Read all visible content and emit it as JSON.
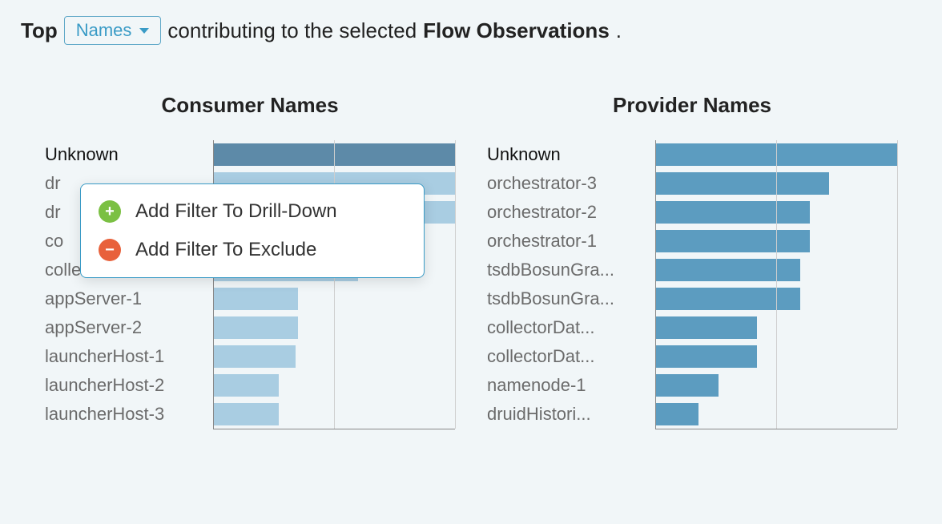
{
  "header": {
    "top": "Top",
    "dropdown_label": "Names",
    "middle": "contributing to the selected",
    "bold": "Flow Observations",
    "period": "."
  },
  "context_menu": {
    "add_drilldown": "Add Filter To Drill-Down",
    "add_exclude": "Add Filter To Exclude"
  },
  "colors": {
    "consumer_selected": "#5d8aa8",
    "consumer_bar": "#a9cde2",
    "provider_bar": "#5c9cc0"
  },
  "chart_data": [
    {
      "type": "bar",
      "title": "Consumer Names",
      "orientation": "horizontal",
      "xlim": [
        0,
        100
      ],
      "grid_ticks": [
        0,
        50,
        100
      ],
      "categories": [
        "Unknown",
        "dr",
        "dr",
        "co",
        "collectorDat...",
        "appServer-1",
        "appServer-2",
        "launcherHost-1",
        "launcherHost-2",
        "launcherHost-3"
      ],
      "values": [
        100,
        100,
        100,
        80,
        60,
        35,
        35,
        34,
        27,
        27
      ],
      "selected_index": 0,
      "obscured_indices": [
        1,
        2,
        3
      ]
    },
    {
      "type": "bar",
      "title": "Provider Names",
      "orientation": "horizontal",
      "xlim": [
        0,
        100
      ],
      "grid_ticks": [
        0,
        50,
        100
      ],
      "categories": [
        "Unknown",
        "orchestrator-3",
        "orchestrator-2",
        "orchestrator-1",
        "tsdbBosunGra...",
        "tsdbBosunGra...",
        "collectorDat...",
        "collectorDat...",
        "namenode-1",
        "druidHistori..."
      ],
      "values": [
        100,
        72,
        64,
        64,
        60,
        60,
        42,
        42,
        26,
        18
      ]
    }
  ]
}
